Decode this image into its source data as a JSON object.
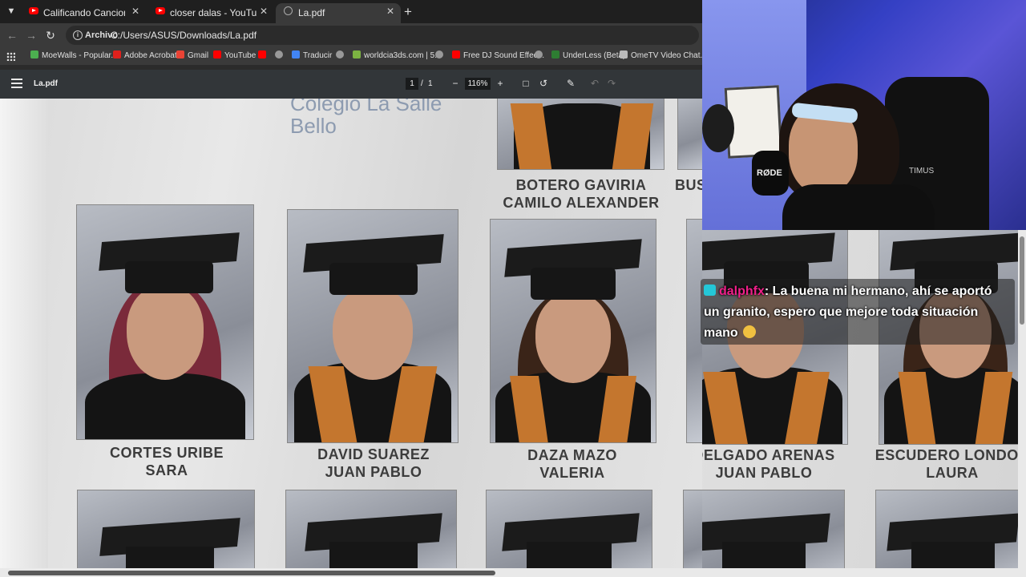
{
  "browser": {
    "tabs": [
      {
        "title": "Calificando Canciones de Youtu",
        "icon": "youtube-icon",
        "active": false
      },
      {
        "title": "closer dalas - YouTube",
        "icon": "youtube-icon",
        "active": false
      },
      {
        "title": "La.pdf",
        "icon": "globe-icon",
        "active": true
      }
    ],
    "address": {
      "chip": "Archivo",
      "url": "C:/Users/ASUS/Downloads/La.pdf"
    },
    "bookmarks": [
      "MoeWalls - Popular...",
      "Adobe Acrobat",
      "Gmail",
      "YouTube",
      "Traducir",
      "worldcia3ds.com | 5...",
      "Free DJ Sound Effec...",
      "UnderLess (Beta)",
      "OmeTV Video Chat..."
    ]
  },
  "pdf": {
    "filename": "La.pdf",
    "current_page": "1",
    "page_separator": "/",
    "total_pages": "1",
    "zoom": "116%",
    "school": "Colegio La Salle\nBello",
    "students_row1": [
      {
        "line1": "CORTES URIBE",
        "line2": "SARA"
      },
      {
        "line1": "DAVID SUAREZ",
        "line2": "JUAN PABLO"
      },
      {
        "line1": "DAZA MAZO",
        "line2": "VALERIA"
      },
      {
        "line1": "DELGADO ARENAS",
        "line2": "JUAN PABLO"
      },
      {
        "line1": "ESCUDERO LONDOÑ",
        "line2": "LAURA"
      }
    ],
    "student_top": {
      "line1": "BOTERO GAVIRIA",
      "line2": "CAMILO ALEXANDER"
    },
    "student_top_partial": "BUS"
  },
  "webcam": {
    "mic_label": "RØDE",
    "chair_label": "TIMUS"
  },
  "chat": {
    "username": "dalphfx",
    "separator": ": ",
    "message": "La buena mi hermano, ahí se aportó un granito, espero que mejore toda situación mano"
  },
  "colors": {
    "accent_stole": "#c4762e",
    "chat_user": "#f0208a",
    "badge": "#24c7d8"
  }
}
